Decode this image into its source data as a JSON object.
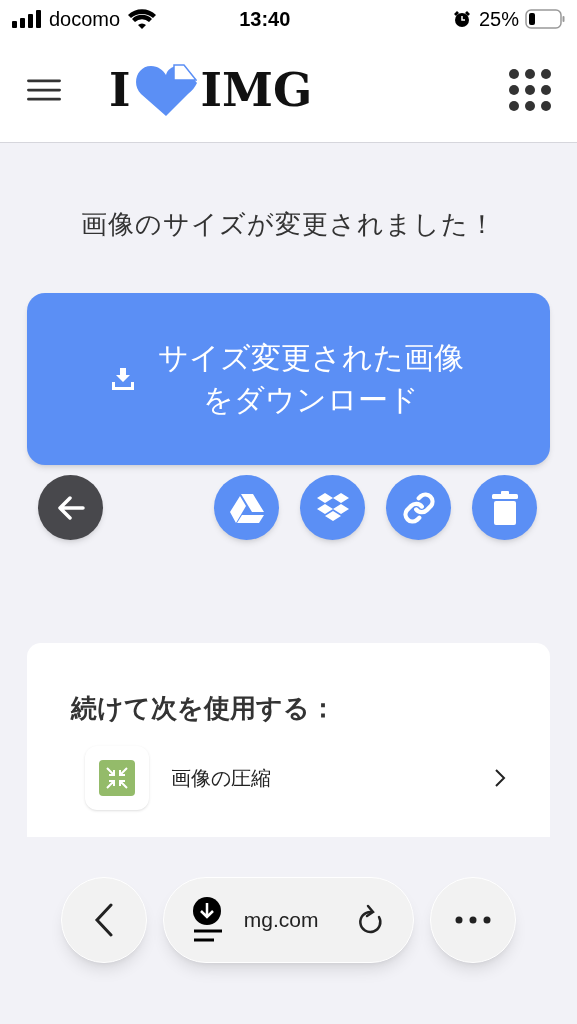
{
  "status_bar": {
    "carrier": "docomo",
    "time": "13:40",
    "battery": "25%"
  },
  "header": {
    "logo": {
      "left": "I",
      "right": "IMG"
    }
  },
  "message": "画像のサイズが変更されました！",
  "download_button": {
    "label": "サイズ変更された画像をダウンロード"
  },
  "actions": [
    {
      "kind": "back"
    },
    {
      "kind": "drive"
    },
    {
      "kind": "dropbox"
    },
    {
      "kind": "link"
    },
    {
      "kind": "delete"
    }
  ],
  "continue": {
    "heading": "続けて次を使用する：",
    "tools": [
      {
        "kind": "compress",
        "label": "画像の圧縮"
      }
    ]
  },
  "browser_bar": {
    "url": "mg.com"
  }
}
